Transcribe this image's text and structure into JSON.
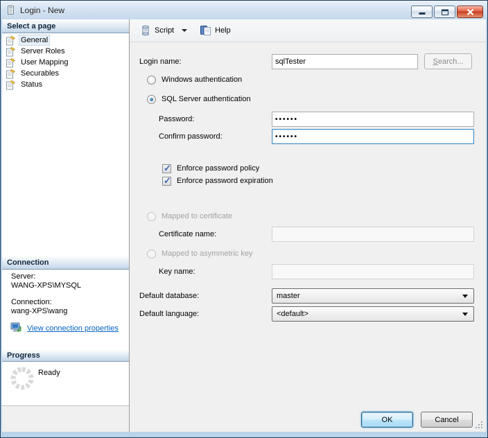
{
  "window": {
    "title": "Login - New"
  },
  "sidebar": {
    "select_page": {
      "header": "Select a page",
      "pages": [
        {
          "label": "General"
        },
        {
          "label": "Server Roles"
        },
        {
          "label": "User Mapping"
        },
        {
          "label": "Securables"
        },
        {
          "label": "Status"
        }
      ]
    },
    "connection": {
      "header": "Connection",
      "server_label": "Server:",
      "server_value": "WANG-XPS\\MYSQL",
      "connection_label": "Connection:",
      "connection_value": "wang-XPS\\wang",
      "view_link": "View connection properties"
    },
    "progress": {
      "header": "Progress",
      "status": "Ready"
    }
  },
  "toolbar": {
    "script": "Script",
    "help": "Help"
  },
  "form": {
    "login_name_label": "Login name:",
    "login_name_value": "sqlTester",
    "search_button": "Search...",
    "windows_auth_label": "Windows authentication",
    "sql_auth_label": "SQL Server authentication",
    "password_label": "Password:",
    "password_value": "••••••",
    "confirm_password_label": "Confirm password:",
    "confirm_password_value": "••••••",
    "enforce_policy_label": "Enforce password policy",
    "enforce_expiration_label": "Enforce password expiration",
    "mapped_certificate_label": "Mapped to certificate",
    "certificate_name_label": "Certificate name:",
    "certificate_name_value": "",
    "mapped_asymmetric_label": "Mapped to asymmetric key",
    "key_name_label": "Key name:",
    "key_name_value": "",
    "default_database_label": "Default database:",
    "default_database_value": "master",
    "default_language_label": "Default language:",
    "default_language_value": "<default>"
  },
  "footer": {
    "ok": "OK",
    "cancel": "Cancel"
  },
  "colors": {
    "link": "#0563c1",
    "titlebar": "#d5e3f2",
    "default_button_border": "#2c628b",
    "close_button": "#c63a1f"
  }
}
